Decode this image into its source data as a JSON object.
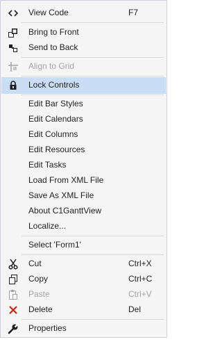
{
  "menu": {
    "view_code": {
      "label": "View Code",
      "shortcut": "F7"
    },
    "bring_to_front": {
      "label": "Bring to Front"
    },
    "send_to_back": {
      "label": "Send to Back"
    },
    "align_to_grid": {
      "label": "Align to Grid"
    },
    "lock_controls": {
      "label": "Lock Controls"
    },
    "edit_bar_styles": {
      "label": "Edit Bar Styles"
    },
    "edit_calendars": {
      "label": "Edit Calendars"
    },
    "edit_columns": {
      "label": "Edit Columns"
    },
    "edit_resources": {
      "label": "Edit Resources"
    },
    "edit_tasks": {
      "label": "Edit Tasks"
    },
    "load_from_xml": {
      "label": "Load From XML File"
    },
    "save_as_xml": {
      "label": "Save As XML File"
    },
    "about": {
      "label": "About C1GanttView"
    },
    "localize": {
      "label": "Localize..."
    },
    "select_form": {
      "label": "Select 'Form1'"
    },
    "cut": {
      "label": "Cut",
      "shortcut": "Ctrl+X"
    },
    "copy": {
      "label": "Copy",
      "shortcut": "Ctrl+C"
    },
    "paste": {
      "label": "Paste",
      "shortcut": "Ctrl+V"
    },
    "delete": {
      "label": "Delete",
      "shortcut": "Del"
    },
    "properties": {
      "label": "Properties"
    }
  },
  "colors": {
    "highlight": "#c9def5",
    "disabled": "#a2a4a5",
    "delete_icon": "#e51400"
  }
}
